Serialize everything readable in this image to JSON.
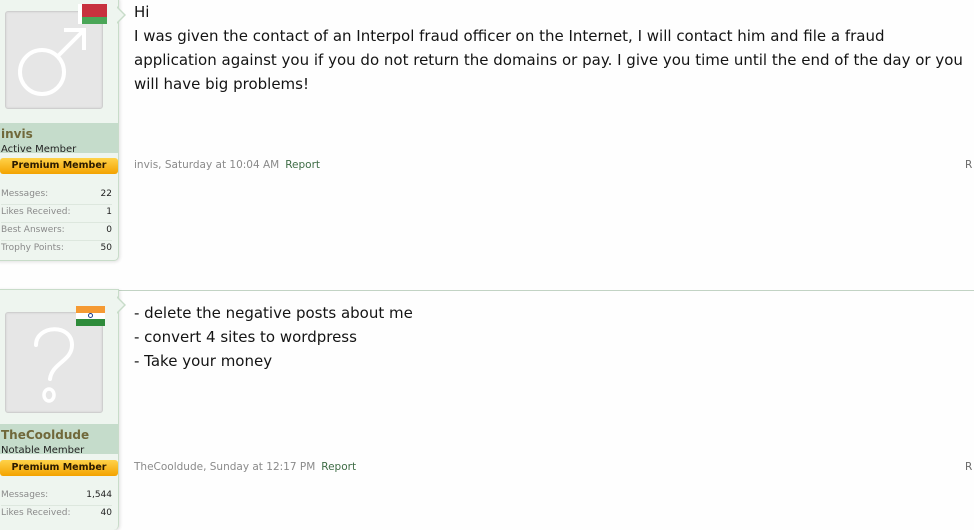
{
  "posts": [
    {
      "username": "invis",
      "user_title": "Active Member",
      "badge": "Premium Member",
      "avatar_icon": "male-symbol-icon",
      "flag_icon": "belarus-flag-icon",
      "stats": [
        {
          "label": "Messages:",
          "value": "22"
        },
        {
          "label": "Likes Received:",
          "value": "1"
        },
        {
          "label": "Best Answers:",
          "value": "0"
        },
        {
          "label": "Trophy Points:",
          "value": "50"
        }
      ],
      "message": [
        "Hi",
        "I was given the contact of an Interpol fraud officer on the Internet, I will contact him and file a fraud application against you if you do not return the domains or pay. I give you time until the end of the day or you will have big problems!"
      ],
      "meta": "invis, Saturday at 10:04 AM",
      "report_label": "Report",
      "reply_label": "R"
    },
    {
      "username": "TheCooldude",
      "user_title": "Notable Member",
      "badge": "Premium Member",
      "avatar_icon": "question-mark-icon",
      "flag_icon": "india-flag-icon",
      "stats": [
        {
          "label": "Messages:",
          "value": "1,544"
        },
        {
          "label": "Likes Received:",
          "value": "40"
        }
      ],
      "message": [
        "- delete the negative posts about me",
        "- convert 4 sites to wordpress",
        "- Take your money"
      ],
      "meta": "TheCooldude, Sunday at 12:17 PM",
      "report_label": "Report",
      "reply_label": "R"
    }
  ],
  "colors": {
    "user_card_bg": "#eef5ef",
    "username_band": "#c5dccb",
    "username_text": "#70683a",
    "premium_badge": "#f3a200",
    "report_link": "#3e6c45"
  }
}
